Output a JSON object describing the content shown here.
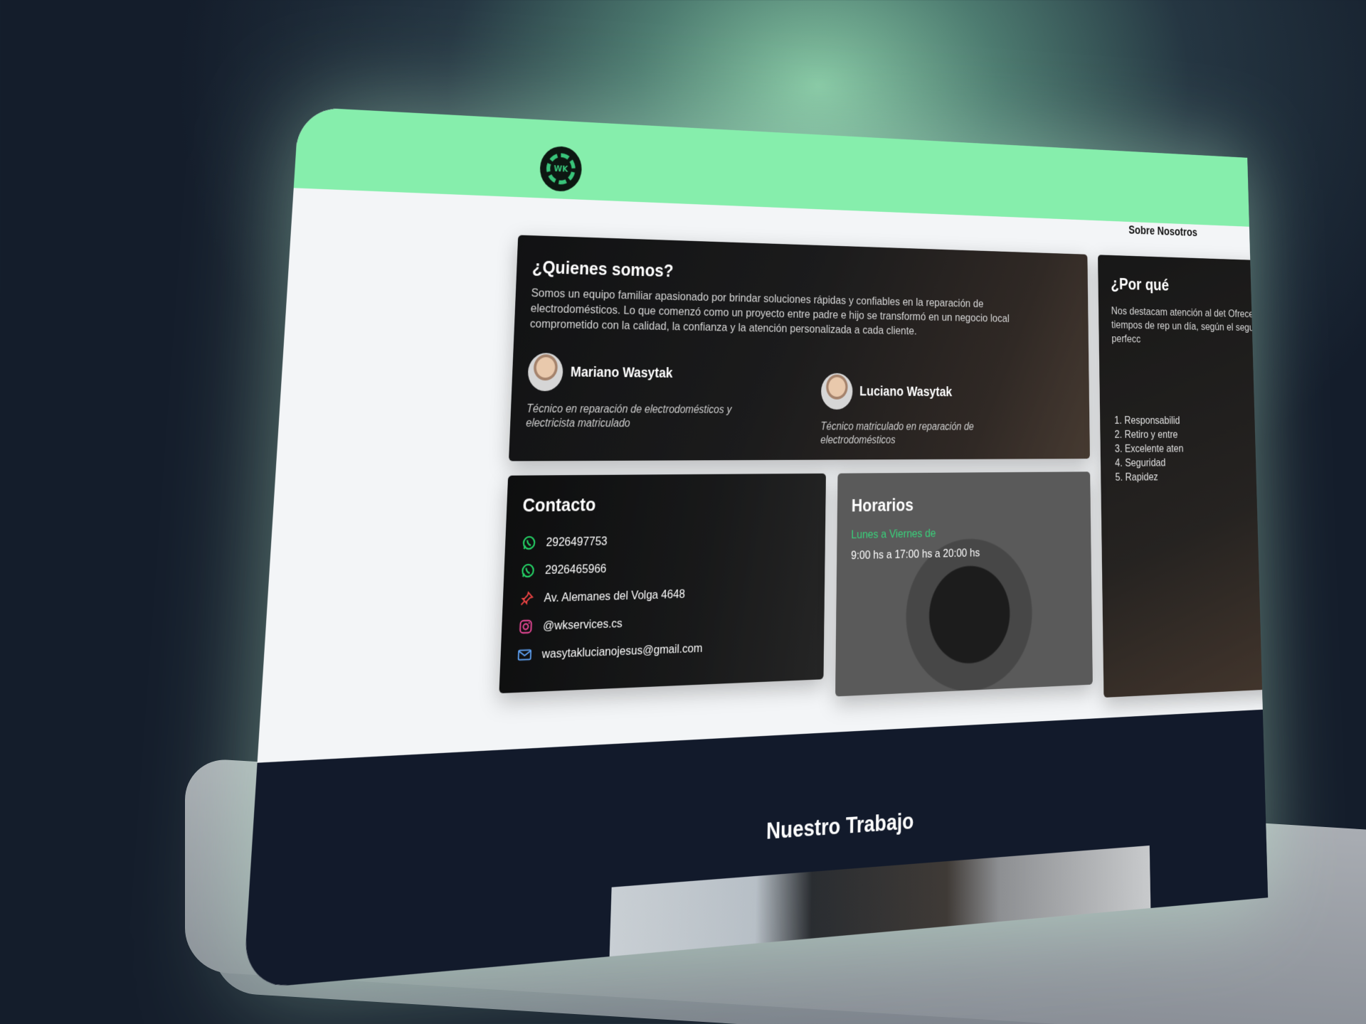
{
  "header": {
    "logo_text": "WK",
    "nav_item": "Sobre Nosotros"
  },
  "about": {
    "title": "¿Quienes somos?",
    "text": "Somos un equipo familiar apasionado por brindar soluciones rápidas y confiables en la reparación de electrodomésticos. Lo que comenzó como un proyecto entre padre e hijo se transformó en un negocio local comprometido con la calidad, la confianza y la atención personalizada a cada cliente.",
    "people": [
      {
        "name": "Mariano Wasytak",
        "role": "Técnico en reparación de electrodomésticos y electricista matriculado"
      },
      {
        "name": "Luciano Wasytak",
        "role": "Técnico matriculado en reparación de electrodomésticos"
      }
    ]
  },
  "why": {
    "title": "¿Por qué",
    "text": "Nos destacam atención al det Ofrecemos serv tiempos de rep un día, según el seguro y perfecc",
    "list": [
      "Responsabilid",
      "Retiro y entre",
      "Excelente aten",
      "Seguridad",
      "Rapidez"
    ]
  },
  "contact": {
    "title": "Contacto",
    "items": [
      {
        "icon": "whatsapp-icon",
        "text": "2926497753",
        "color": "#25d366"
      },
      {
        "icon": "whatsapp-icon",
        "text": "2926465966",
        "color": "#25d366"
      },
      {
        "icon": "pin-icon",
        "text": "Av. Alemanes del Volga 4648",
        "color": "#ef4444"
      },
      {
        "icon": "instagram-icon",
        "text": "@wkservices.cs",
        "color": "#ec4899"
      },
      {
        "icon": "mail-icon",
        "text": "wasytaklucianojesus@gmail.com",
        "color": "#60a5fa"
      }
    ]
  },
  "hours": {
    "title": "Horarios",
    "days": "Lunes a Viernes de",
    "time": "9:00 hs a 17:00 hs a 20:00 hs"
  },
  "footer": {
    "title": "Nuestro Trabajo"
  },
  "colors": {
    "header_green": "#86eeac",
    "accent_green": "#39d27b",
    "footer_navy": "#121a2b"
  }
}
